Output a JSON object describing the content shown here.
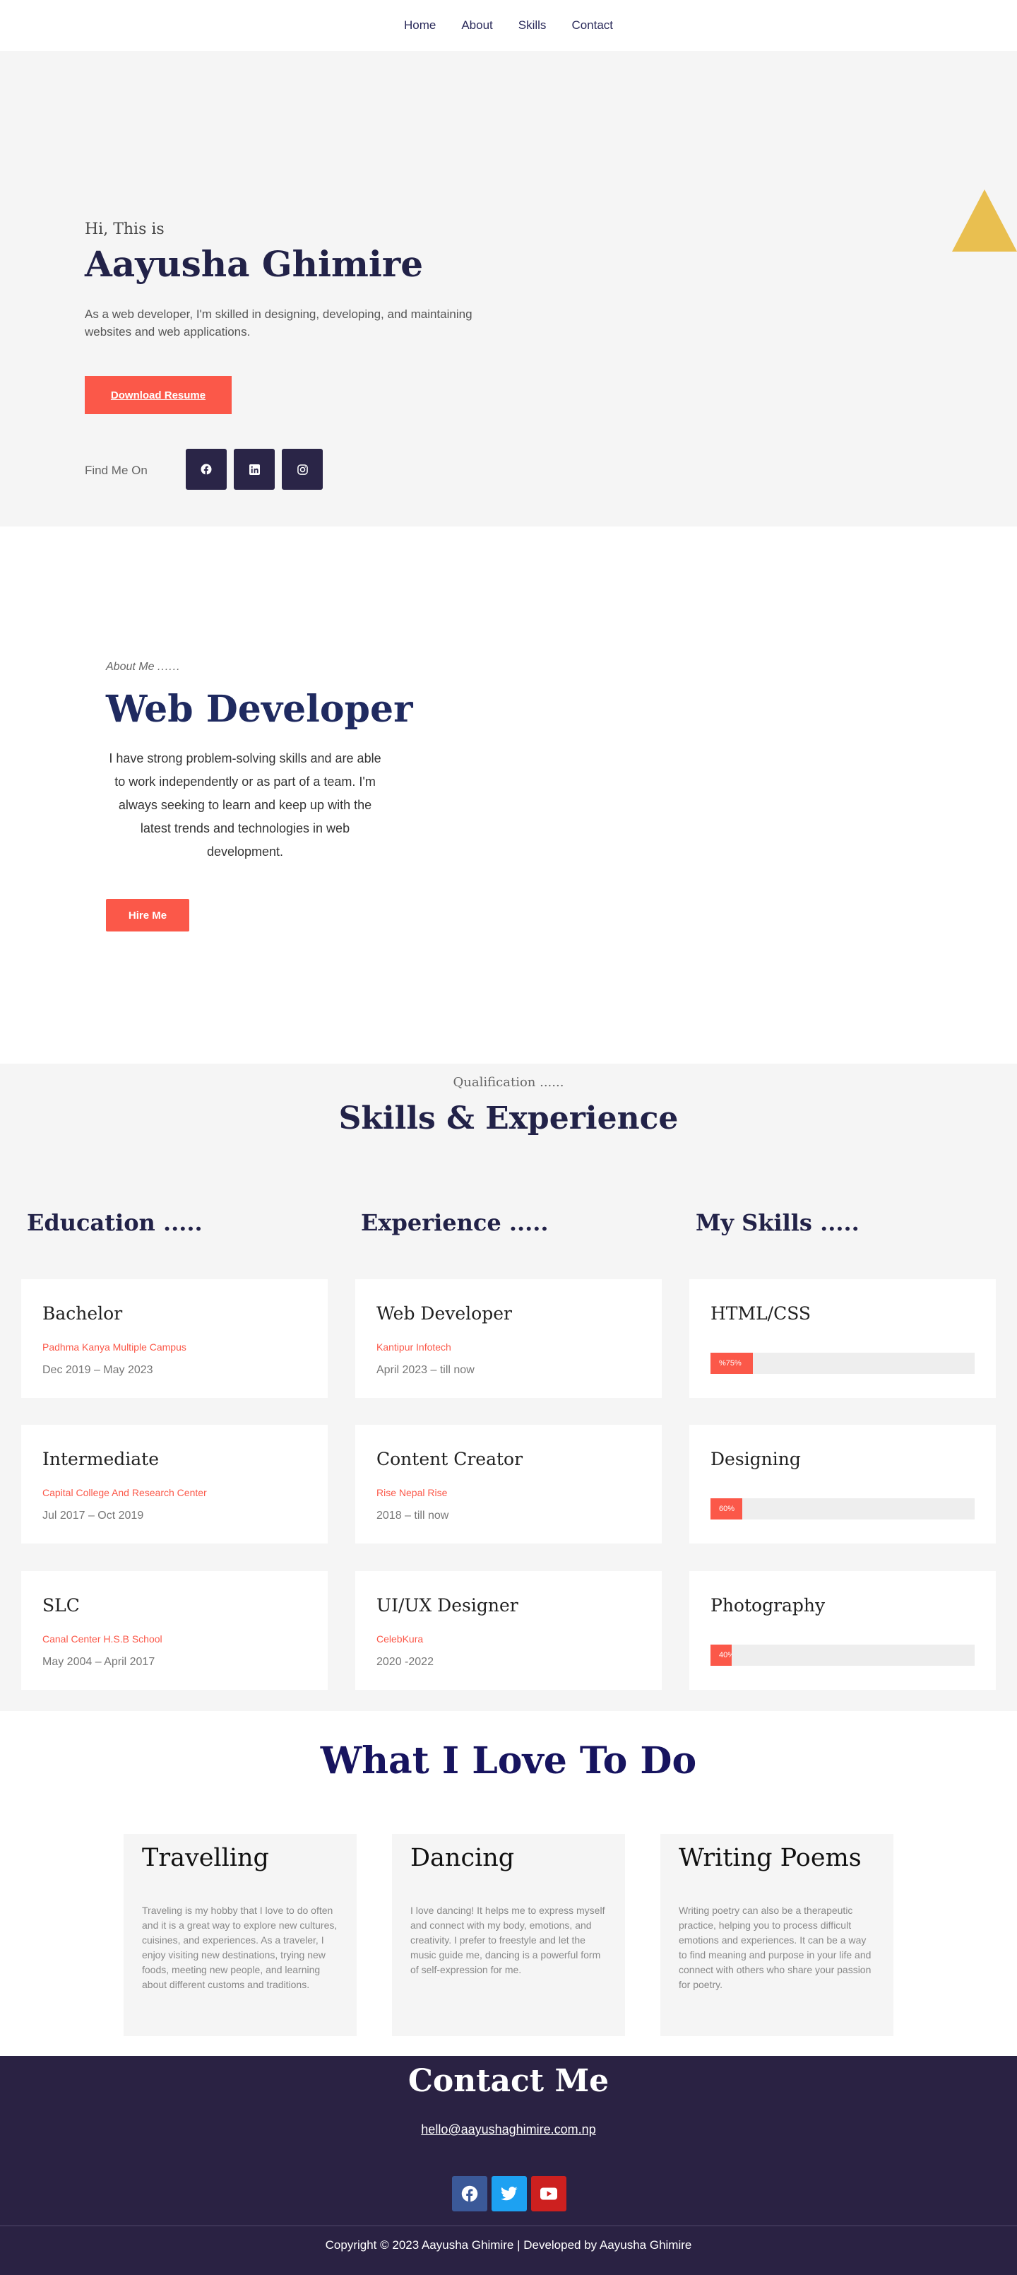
{
  "nav": {
    "items": [
      "Home",
      "About",
      "Skills",
      "Contact"
    ]
  },
  "hero": {
    "greeting": "Hi, This is",
    "name": "Aayusha Ghimire",
    "intro": "As a web developer, I'm skilled in designing, developing, and maintaining websites and web applications.",
    "resume_button": "Download Resume",
    "find_me_label": "Find Me On",
    "social_icons": [
      "facebook-icon",
      "linkedin-icon",
      "instagram-icon"
    ],
    "accent_color": "#e9bf50"
  },
  "about": {
    "label": "About Me",
    "label_dots": "......",
    "title": "Web Developer",
    "text": "I have strong problem-solving skills and are able to work independently or as part of a team. I'm always seeking to learn and keep up with the latest trends and technologies in web development.",
    "hire_button": "Hire Me"
  },
  "skills": {
    "qualification_label": "Qualification ......",
    "title": "Skills & Experience",
    "education_heading": "Education .....",
    "experience_heading": "Experience .....",
    "myskills_heading": "My Skills .....",
    "education": [
      {
        "title": "Bachelor",
        "org": "Padhma Kanya Multiple Campus",
        "date": "Dec 2019 – May 2023"
      },
      {
        "title": "Intermediate",
        "org": "Capital College And Research Center",
        "date": "Jul 2017 – Oct 2019"
      },
      {
        "title": "SLC",
        "org": "Canal Center H.S.B School",
        "date": "May 2004 – April 2017"
      }
    ],
    "experience": [
      {
        "title": "Web Developer",
        "org": "Kantipur Infotech",
        "date": "April 2023 – till now"
      },
      {
        "title": "Content Creator",
        "org": "Rise Nepal Rise",
        "date": "2018 – till now"
      },
      {
        "title": "UI/UX Designer",
        "org": "CelebKura",
        "date": "2020 -2022"
      }
    ],
    "my_skills": [
      {
        "title": "HTML/CSS",
        "label": "%75%",
        "fraction": 0.16
      },
      {
        "title": "Designing",
        "label": "60%",
        "fraction": 0.12
      },
      {
        "title": "Photography",
        "label": "40%",
        "fraction": 0.08
      }
    ],
    "accent_color": "#fb5849"
  },
  "love": {
    "title": "What I Love To Do",
    "items": [
      {
        "title": "Travelling",
        "text": "Traveling is my hobby that I love to do often and it is a great way to explore new cultures, cuisines, and experiences. As a traveler, I enjoy visiting new destinations, trying new foods, meeting new people, and learning about different customs and traditions."
      },
      {
        "title": "Dancing",
        "text": "I love dancing! It helps me to express myself and connect with my body, emotions, and creativity. I prefer to freestyle and let the music guide me, dancing is a powerful form of self-expression for me."
      },
      {
        "title": "Writing Poems",
        "text": "Writing poetry can also be a therapeutic practice, helping you to process difficult emotions and experiences. It can be a way to find meaning and purpose in your life and connect with others who share your passion for poetry."
      }
    ]
  },
  "contact": {
    "title": "Contact Me",
    "email": "hello@aayushaghimire.com.np",
    "social_icons": [
      "facebook-icon",
      "twitter-icon",
      "youtube-icon"
    ],
    "social_colors": [
      "#3b5998",
      "#1da1f2",
      "#cd201f"
    ],
    "copyright": "Copyright © 2023 Aayusha Ghimire | Developed by Aayusha Ghimire"
  }
}
